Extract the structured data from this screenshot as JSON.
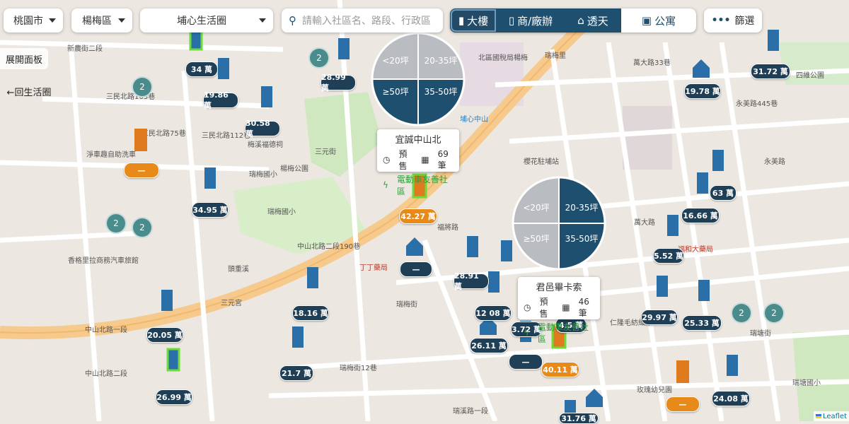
{
  "filters": {
    "city": "桃園市",
    "district": "楊梅區",
    "circle": "埔心生活圈",
    "search_placeholder": "請輸入社區名、路段、行政區"
  },
  "type_tabs": [
    {
      "label": "大樓",
      "icon": "building-icon"
    },
    {
      "label": "商/廠辦",
      "icon": "office-icon"
    },
    {
      "label": "透天",
      "icon": "house-icon"
    },
    {
      "label": "公寓",
      "icon": "apartment-icon"
    }
  ],
  "filter_button": {
    "label": "篩選",
    "icon": "dots-icon"
  },
  "side": {
    "expand_label": "展開面板",
    "back_label": "←回生活圈"
  },
  "size_wheel_1": {
    "tl": "<20坪",
    "tr": "20-35坪",
    "bl": "≥50坪",
    "br": "35-50坪"
  },
  "size_wheel_2": {
    "tl": "<20坪",
    "tr": "20-35坪",
    "bl": "≥50坪",
    "br": "35-50坪"
  },
  "popup_1": {
    "title": "宜誠中山北",
    "status": "預售",
    "count": "69筆",
    "ev": "電動車友善社區"
  },
  "popup_2": {
    "title": "君邑畢卡索",
    "status": "預售",
    "count": "46筆",
    "ev": "電動車友善社區"
  },
  "prices": {
    "p1": "34 萬",
    "p2": "19.86 萬",
    "p3": "28.99 萬",
    "p4": "30.58 萬",
    "p5": "—",
    "p6": "34.95 萬",
    "p7": "42.27 萬",
    "p8": "—",
    "p9": "28.91 萬",
    "p10": "18.16 萬",
    "p11": "20.05 萬",
    "p12": "21.7 萬",
    "p13": "26.99 萬",
    "p14": "12 08 萬",
    "p15": "26.11 萬",
    "p16": "—",
    "p17": "40.11 萬",
    "p18": "31.72 萬",
    "p19": "19.78 萬",
    "p20": "63 萬",
    "p21": "16.66 萬",
    "p22": "5.52 萬",
    "p23": "29.97 萬",
    "p24": "25.33 萬",
    "p25": "—",
    "p26": "24.08 萬",
    "p27": "31.76 萬",
    "p28": "3.72 萬",
    "p29": "4.5 萬"
  },
  "clusters": {
    "c1": "2",
    "c2": "2",
    "c3": "2",
    "c4": "2",
    "c5": "2",
    "c6": "2"
  },
  "map_labels": {
    "l1": "新農街二段",
    "l2": "三民北路163巷",
    "l3": "三民北路75巷",
    "l4": "梅溪福德祠",
    "l5": "三民北路112巷",
    "l6": "三元街",
    "l7": "瑞梅國小",
    "l8": "中山北路二段190巷",
    "l9": "中山北路一段",
    "l10": "中山北路二段",
    "l11": "瑞梅街12巷",
    "l12": "瑞溪路一段",
    "l13": "北區國稅局楊梅",
    "l14": "瑞梅里",
    "l15": "櫻花駐埔站",
    "l16": "萬大路",
    "l17": "永美路445巷",
    "l18": "四維公園",
    "l19": "瑞塘國小",
    "l20": "仁隆毛紡織廠",
    "l21": "玫瑰幼兒園",
    "l22": "瑞梅街",
    "l23": "福將路",
    "l24": "丁丁藥局",
    "l25": "瑞塘街",
    "l26": "萬大路33巷",
    "l27": "三元宮",
    "l28": "淨車趣自助洗車",
    "l29": "香格里拉商務汽車旅館",
    "l30": "埔心中山",
    "l31": "楊梅公園",
    "l32": "永美路",
    "l33": "福和大藥局",
    "l34": "瑞梅國小",
    "l35": "頭重溪"
  },
  "attribution": "Leaflet"
}
